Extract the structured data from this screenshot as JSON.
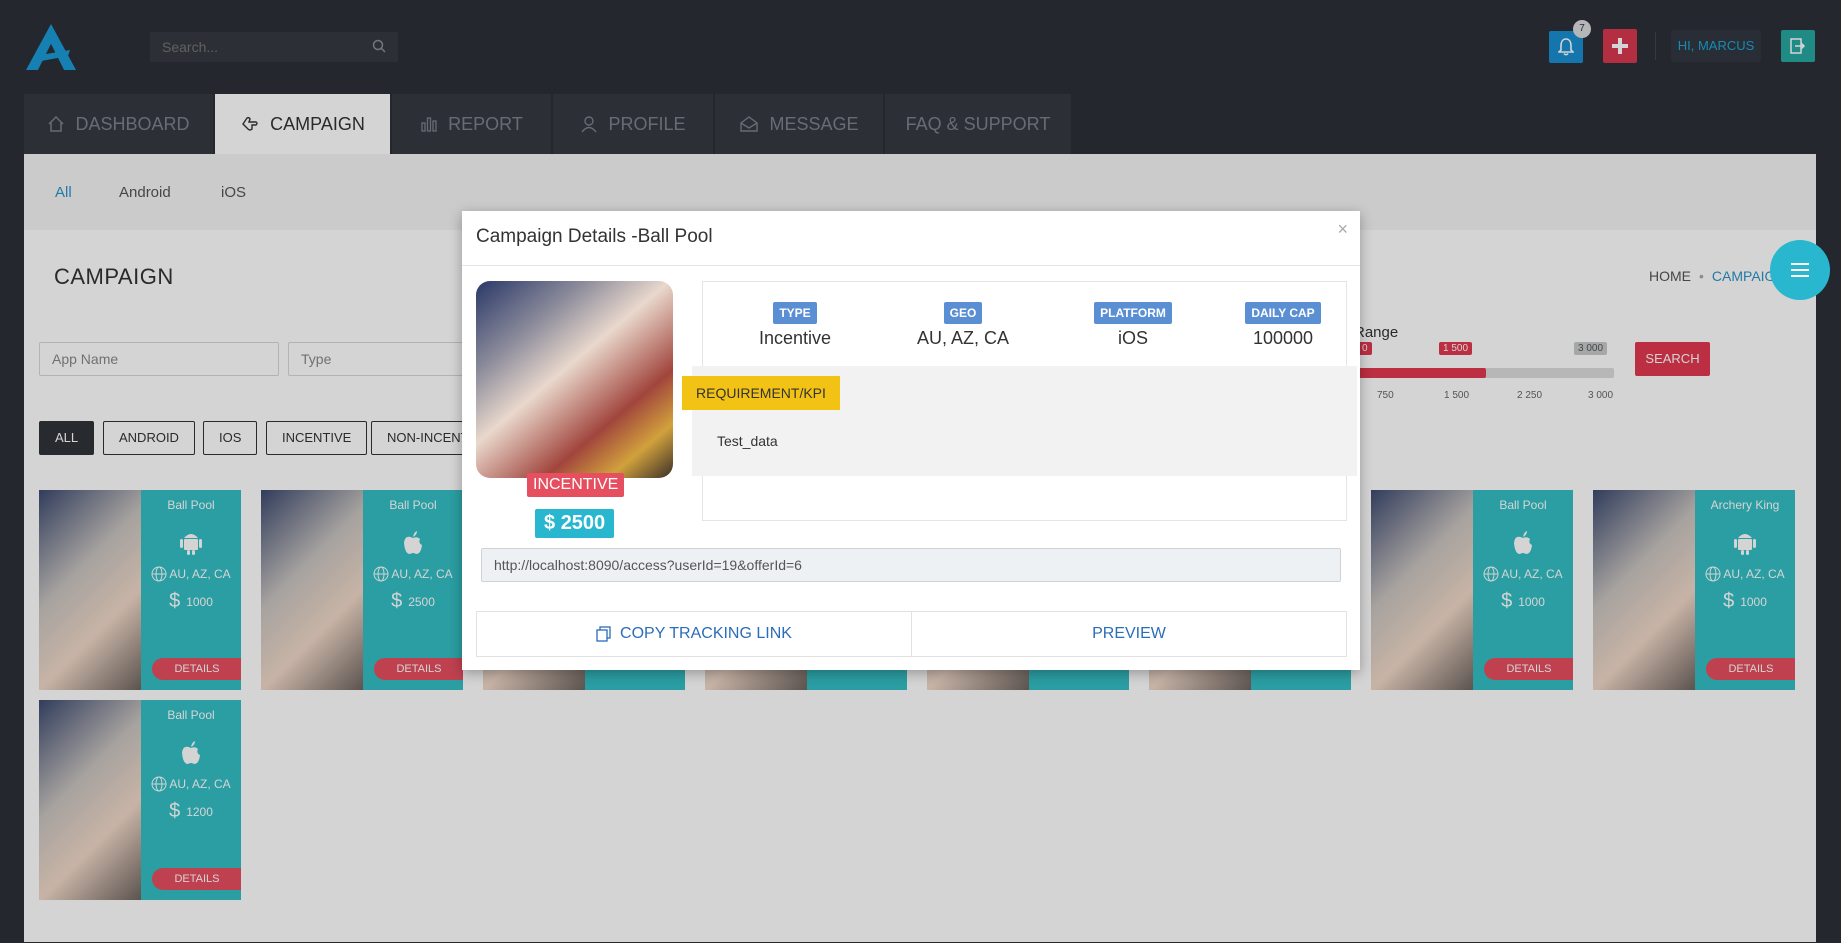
{
  "header": {
    "search_placeholder": "Search...",
    "notification_count": "7",
    "user_label": "HI, MARCUS"
  },
  "tabs": [
    {
      "label": "DASHBOARD",
      "icon": "home-icon"
    },
    {
      "label": "CAMPAIGN",
      "icon": "hand-icon"
    },
    {
      "label": "REPORT",
      "icon": "bar-chart-icon"
    },
    {
      "label": "PROFILE",
      "icon": "user-icon"
    },
    {
      "label": "MESSAGE",
      "icon": "envelope-icon"
    },
    {
      "label": "FAQ & SUPPORT",
      "icon": ""
    }
  ],
  "subnav": {
    "items": [
      "All",
      "Android",
      "iOS"
    ]
  },
  "page": {
    "title": "CAMPAIGN",
    "breadcrumb": {
      "home": "HOME",
      "current": "CAMPAIGN"
    }
  },
  "filters": {
    "app_name_placeholder": "App Name",
    "type_placeholder": "Type",
    "range_label": "Range",
    "range_min_tip": "0",
    "range_value_tip": "1 500",
    "range_max_tip": "3 000",
    "range_value": 1500,
    "range_max": 3000,
    "ticks": [
      "750",
      "1 500",
      "2 250",
      "3 000"
    ],
    "search_button": "SEARCH",
    "chips": [
      "ALL",
      "ANDROID",
      "IOS",
      "INCENTIVE",
      "NON-INCENTIVE"
    ]
  },
  "cards": [
    {
      "name": "Ball Pool",
      "os": "android",
      "geo": "AU, AZ, CA",
      "payout": "1000",
      "button": "DETAILS"
    },
    {
      "name": "Ball Pool",
      "os": "ios",
      "geo": "AU, AZ, CA",
      "payout": "2500",
      "button": "DETAILS"
    },
    {
      "name": "Ball Pool",
      "os": "ios",
      "geo": "AU, AZ, CA",
      "payout": "1000",
      "button": "DETAILS"
    },
    {
      "name": "Archery King",
      "os": "android",
      "geo": "AU, AZ, CA",
      "payout": "1000",
      "button": "DETAILS"
    },
    {
      "name": "Ball Pool",
      "os": "ios",
      "geo": "AU, AZ, CA",
      "payout": "1200",
      "button": "DETAILS"
    }
  ],
  "modal": {
    "title": "Campaign Details -Ball Pool",
    "close": "×",
    "incentive_badge": "INCENTIVE",
    "payout": "2500",
    "info": [
      {
        "label": "TYPE",
        "value": "Incentive"
      },
      {
        "label": "GEO",
        "value": "AU, AZ, CA"
      },
      {
        "label": "PLATFORM",
        "value": "iOS"
      },
      {
        "label": "DAILY CAP",
        "value": "100000"
      }
    ],
    "requirement_label": "REQUIREMENT/KPI",
    "requirement_text": "Test_data",
    "tracking_link": "http://localhost:8090/access?userId=19&offerId=6",
    "copy_button": "COPY TRACKING LINK",
    "preview_button": "PREVIEW"
  }
}
